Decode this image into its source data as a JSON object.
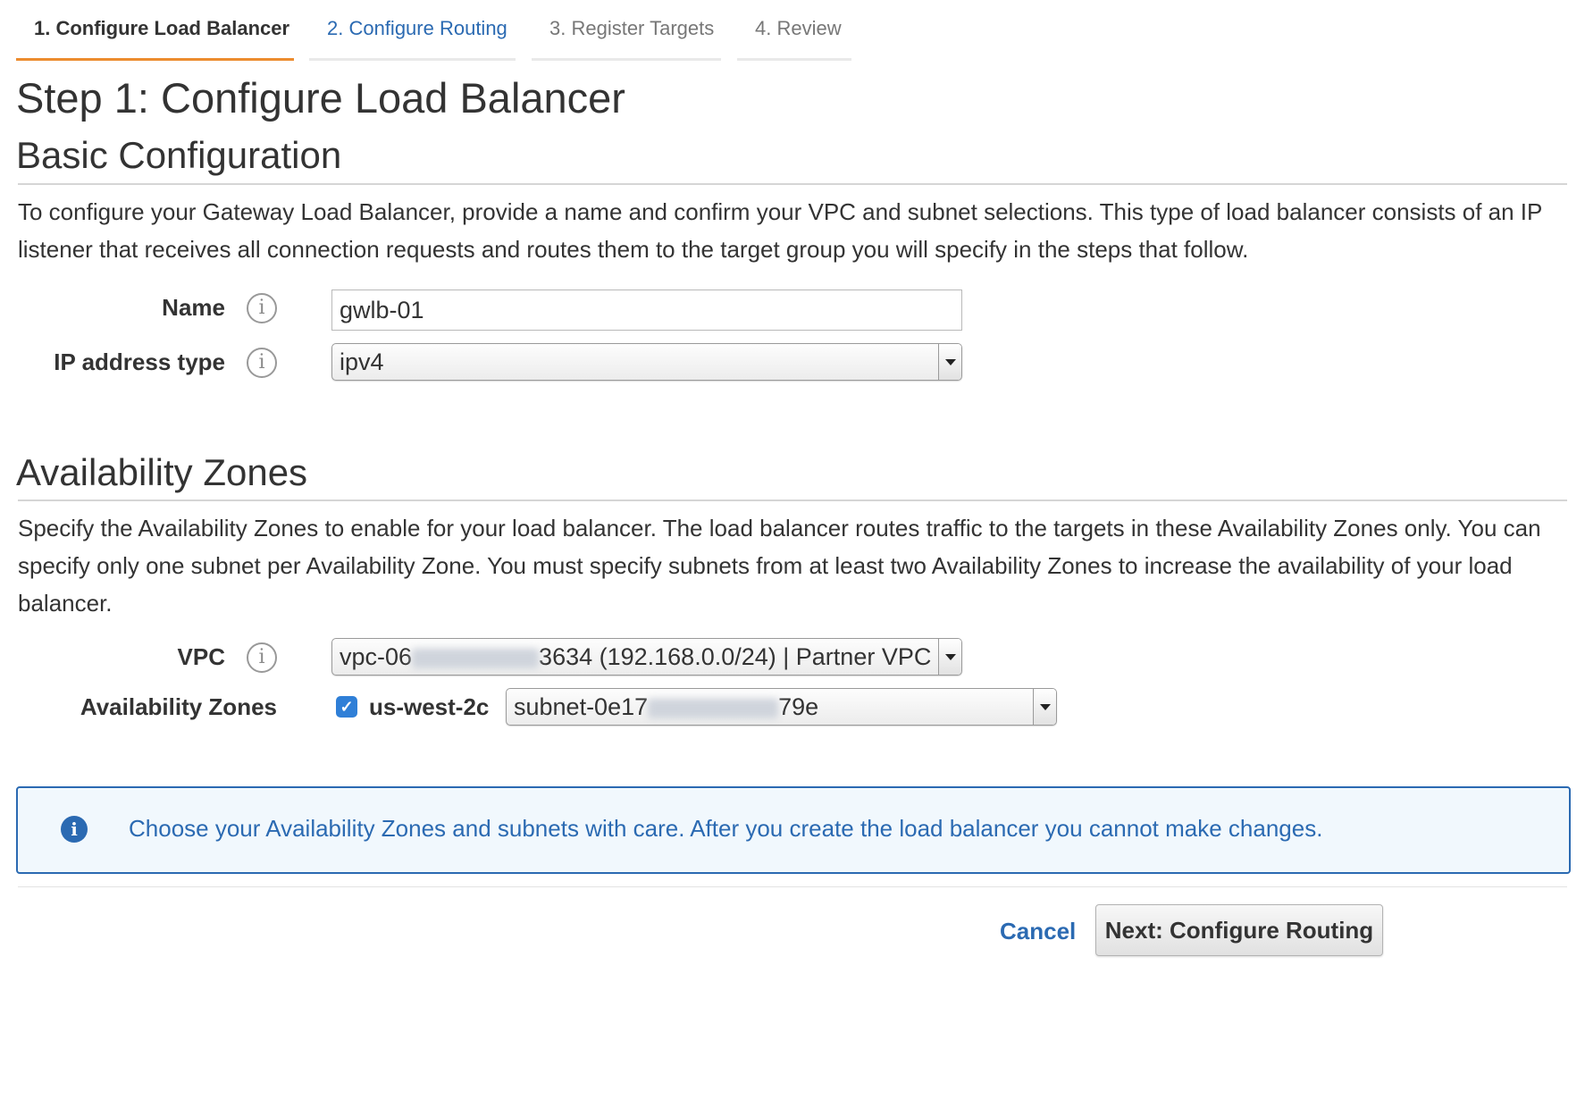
{
  "wizard": {
    "tabs": [
      {
        "label": "1. Configure Load Balancer",
        "state": "active"
      },
      {
        "label": "2. Configure Routing",
        "state": "link"
      },
      {
        "label": "3. Register Targets",
        "state": "disabled"
      },
      {
        "label": "4. Review",
        "state": "disabled"
      }
    ]
  },
  "page": {
    "title": "Step 1: Configure Load Balancer"
  },
  "basic": {
    "heading": "Basic Configuration",
    "description": "To configure your Gateway Load Balancer, provide a name and confirm your VPC and subnet selections. This type of load balancer consists of an IP listener that receives all connection requests and routes them to the target group you will specify in the steps that follow.",
    "name_label": "Name",
    "name_value": "gwlb-01",
    "ip_label": "IP address type",
    "ip_value": "ipv4"
  },
  "az": {
    "heading": "Availability Zones",
    "description": "Specify the Availability Zones to enable for your load balancer. The load balancer routes traffic to the targets in these Availability Zones only. You can specify only one subnet per Availability Zone. You must specify subnets from at least two Availability Zones to increase the availability of your load balancer.",
    "vpc_label": "VPC",
    "vpc_value_prefix": "vpc-06",
    "vpc_value_suffix": "3634 (192.168.0.0/24) | Partner VPC",
    "zones_label": "Availability Zones",
    "zone_name": "us-west-2c",
    "zone_checked": true,
    "subnet_prefix": "subnet-0e17",
    "subnet_suffix": "79e"
  },
  "alert": {
    "text": "Choose your Availability Zones and subnets with care. After you create the load balancer you cannot make changes."
  },
  "footer": {
    "cancel_label": "Cancel",
    "next_label": "Next: Configure Routing"
  },
  "colors": {
    "accent_orange": "#ec8c2f",
    "link_blue": "#2b6ab2",
    "checkbox_blue": "#2f7fd7",
    "alert_bg": "#f1f8fd"
  }
}
